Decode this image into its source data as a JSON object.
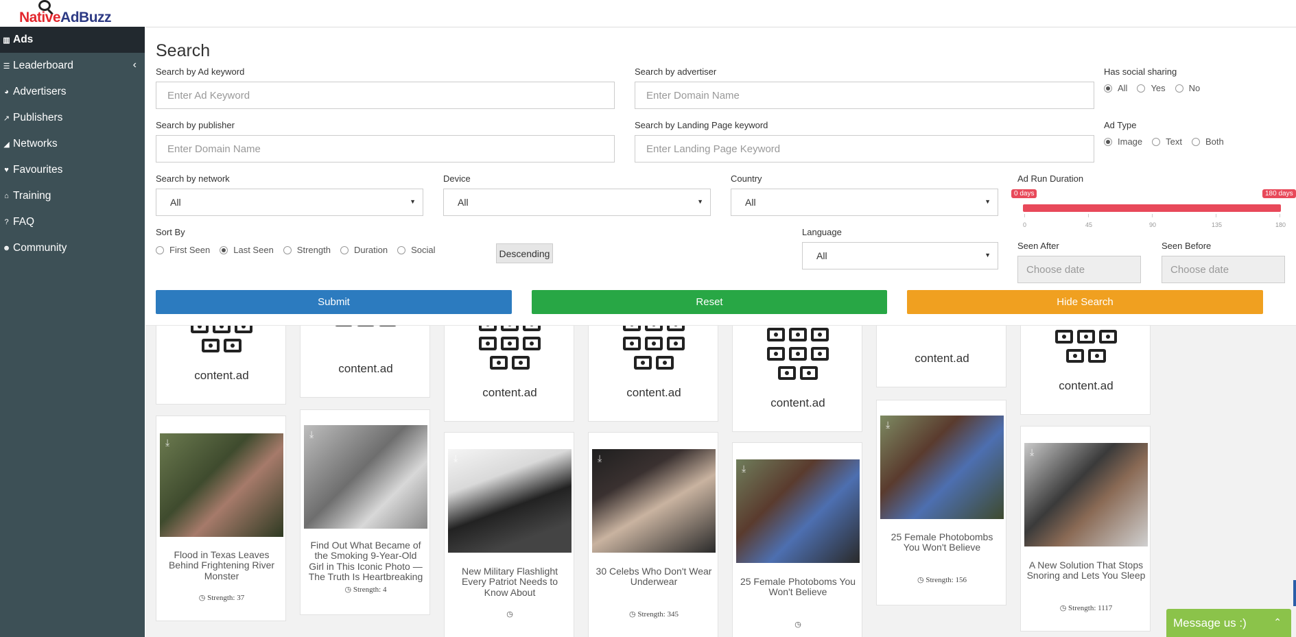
{
  "logo": {
    "part1": "Native",
    "part2": "AdBuzz"
  },
  "sidebar": {
    "items": [
      {
        "label": "Ads",
        "icon": "bar-chart-icon"
      },
      {
        "label": "Leaderboard",
        "icon": "list-icon"
      },
      {
        "label": "Advertisers",
        "icon": "globe-icon"
      },
      {
        "label": "Publishers",
        "icon": "line-chart-icon"
      },
      {
        "label": "Networks",
        "icon": "area-chart-icon"
      },
      {
        "label": "Favourites",
        "icon": "heart-icon"
      },
      {
        "label": "Training",
        "icon": "institution-icon"
      },
      {
        "label": "FAQ",
        "icon": "question-icon"
      },
      {
        "label": "Community",
        "icon": "users-icon"
      }
    ]
  },
  "search": {
    "title": "Search",
    "ad_keyword": {
      "label": "Search by Ad keyword",
      "placeholder": "Enter Ad Keyword"
    },
    "advertiser": {
      "label": "Search by advertiser",
      "placeholder": "Enter Domain Name"
    },
    "social": {
      "label": "Has social sharing",
      "options": [
        "All",
        "Yes",
        "No"
      ],
      "selected": "All"
    },
    "publisher": {
      "label": "Search by publisher",
      "placeholder": "Enter Domain Name"
    },
    "landing": {
      "label": "Search by Landing Page keyword",
      "placeholder": "Enter Landing Page Keyword"
    },
    "ad_type": {
      "label": "Ad Type",
      "options": [
        "Image",
        "Text",
        "Both"
      ],
      "selected": "Image"
    },
    "network": {
      "label": "Search by network",
      "value": "All"
    },
    "device": {
      "label": "Device",
      "value": "All"
    },
    "country": {
      "label": "Country",
      "value": "All"
    },
    "duration": {
      "label": "Ad Run Duration",
      "min_label": "0 days",
      "max_label": "180 days",
      "min": 0,
      "max": 180,
      "ticks": [
        "0",
        "45",
        "90",
        "135",
        "180"
      ]
    },
    "sort": {
      "label": "Sort By",
      "options": [
        "First Seen",
        "Last Seen",
        "Strength",
        "Duration",
        "Social"
      ],
      "selected": "Last Seen",
      "order": "Descending"
    },
    "language": {
      "label": "Language",
      "value": "All"
    },
    "seen_after": {
      "label": "Seen After",
      "placeholder": "Choose date"
    },
    "seen_before": {
      "label": "Seen Before",
      "placeholder": "Choose date"
    },
    "buttons": {
      "submit": "Submit",
      "reset": "Reset",
      "hide": "Hide Search"
    },
    "colors": {
      "submit": "#2c7bbf",
      "reset": "#28a745",
      "hide": "#f0a020"
    }
  },
  "network_cards": [
    {
      "logo": "content.ad"
    },
    {
      "logo": "content.ad"
    },
    {
      "logo": "content.ad"
    },
    {
      "logo": "content.ad"
    },
    {
      "logo": "content.ad"
    },
    {
      "logo": "content.ad"
    },
    {
      "logo": "content.ad"
    }
  ],
  "ads": [
    {
      "title": "Flood in Texas Leaves Behind Frightening River Monster",
      "strength": "Strength: 37"
    },
    {
      "title": "Find Out What Became of the Smoking 9-Year-Old Girl in This Iconic Photo — The Truth Is Heartbreaking",
      "strength": "Strength: 4"
    },
    {
      "title": "New Military Flashlight Every Patriot Needs to Know About",
      "strength": ""
    },
    {
      "title": "30 Celebs Who Don't Wear Underwear",
      "strength": "Strength: 345"
    },
    {
      "title": "25 Female Photoboms You Won't Believe",
      "strength": ""
    },
    {
      "title": "25 Female Photobombs You Won't Believe",
      "strength": "Strength: 156"
    },
    {
      "title": "A New Solution That Stops Snoring and Lets You Sleep",
      "strength": "Strength: 1117"
    }
  ],
  "chat": {
    "label": "Message us :)"
  }
}
